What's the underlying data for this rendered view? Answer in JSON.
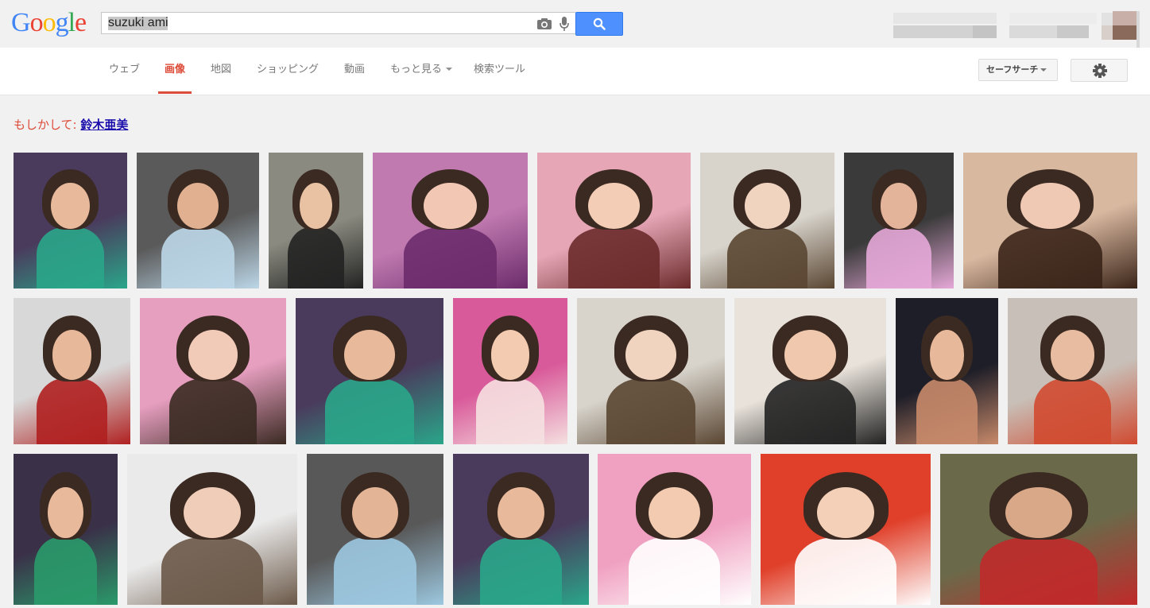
{
  "logo": {
    "letters": [
      "G",
      "o",
      "o",
      "g",
      "l",
      "e"
    ],
    "colors": [
      "#4285f4",
      "#ea4335",
      "#fbbc05",
      "#4285f4",
      "#34a853",
      "#ea4335"
    ]
  },
  "search": {
    "query": "suzuki ami"
  },
  "icons": {
    "camera": "camera-icon",
    "mic": "microphone-icon",
    "search": "search-icon",
    "settings": "gear-icon"
  },
  "nav": {
    "items": [
      {
        "label": "ウェブ",
        "active": false
      },
      {
        "label": "画像",
        "active": true
      },
      {
        "label": "地図",
        "active": false
      },
      {
        "label": "ショッピング",
        "active": false
      },
      {
        "label": "動画",
        "active": false
      },
      {
        "label": "もっと見る",
        "active": false,
        "dropdown": true
      },
      {
        "label": "検索ツール",
        "active": false
      }
    ],
    "safe_search": "セーフサーチ"
  },
  "suggestion": {
    "prefix": "もしかして:",
    "link": "鈴木亜美"
  },
  "colors": {
    "active_tab": "#dd4b39",
    "search_button": "#4d90fe",
    "link": "#1a0dab"
  },
  "thumbnail_rows": [
    [
      {
        "bg": "#4a3a5c",
        "accent": "#2aa68a",
        "face": "#e8b99a"
      },
      {
        "bg": "#5a5a5a",
        "accent": "#bcd7e8",
        "face": "#e0b090"
      },
      {
        "bg": "#8a8a80",
        "accent": "#222222",
        "face": "#e9c2a3"
      },
      {
        "bg": "#c07ab0",
        "accent": "#6b2b6b",
        "face": "#f2c8b5"
      },
      {
        "bg": "#e6a6b6",
        "accent": "#6a2a2a",
        "face": "#f4cdb6"
      },
      {
        "bg": "#d8d4cc",
        "accent": "#5a4632",
        "face": "#f0d4c0"
      },
      {
        "bg": "#3a3a3a",
        "accent": "#e6a8d8",
        "face": "#e4b49a"
      },
      {
        "bg": "#d9b8a0",
        "accent": "#3a2418",
        "face": "#f0c9b5"
      }
    ],
    [
      {
        "bg": "#d8d8d8",
        "accent": "#b02020",
        "face": "#e8b89a"
      },
      {
        "bg": "#e79fc0",
        "accent": "#3a2a22",
        "face": "#f2cbb8"
      },
      {
        "bg": "#4a3a5c",
        "accent": "#2aa68a",
        "face": "#e8b99a"
      },
      {
        "bg": "#d95a9a",
        "accent": "#f5e0e0",
        "face": "#f2cbb0"
      },
      {
        "bg": "#d8d4cc",
        "accent": "#5a4632",
        "face": "#f0d4c0"
      },
      {
        "bg": "#e8e2da",
        "accent": "#222222",
        "face": "#f0c8ae"
      },
      {
        "bg": "#1e1e28",
        "accent": "#c88a6a",
        "face": "#e8b89a"
      },
      {
        "bg": "#c8c0b8",
        "accent": "#d04a30",
        "face": "#e8bca0"
      }
    ],
    [
      {
        "bg": "#3a3048",
        "accent": "#2a9a6a",
        "face": "#e8b99a"
      },
      {
        "bg": "#eaeaea",
        "accent": "#6a5848",
        "face": "#f0cdb8"
      },
      {
        "bg": "#585858",
        "accent": "#9cc8e0",
        "face": "#e4b497"
      },
      {
        "bg": "#4a3a5c",
        "accent": "#2aa68a",
        "face": "#e8b99a"
      },
      {
        "bg": "#f0a0c0",
        "accent": "#ffffff",
        "face": "#f2cbb0"
      },
      {
        "bg": "#e0402a",
        "accent": "#ffffff",
        "face": "#f4d0b8"
      },
      {
        "bg": "#6a6a4a",
        "accent": "#c02a2a",
        "face": "#d8a888"
      }
    ]
  ]
}
